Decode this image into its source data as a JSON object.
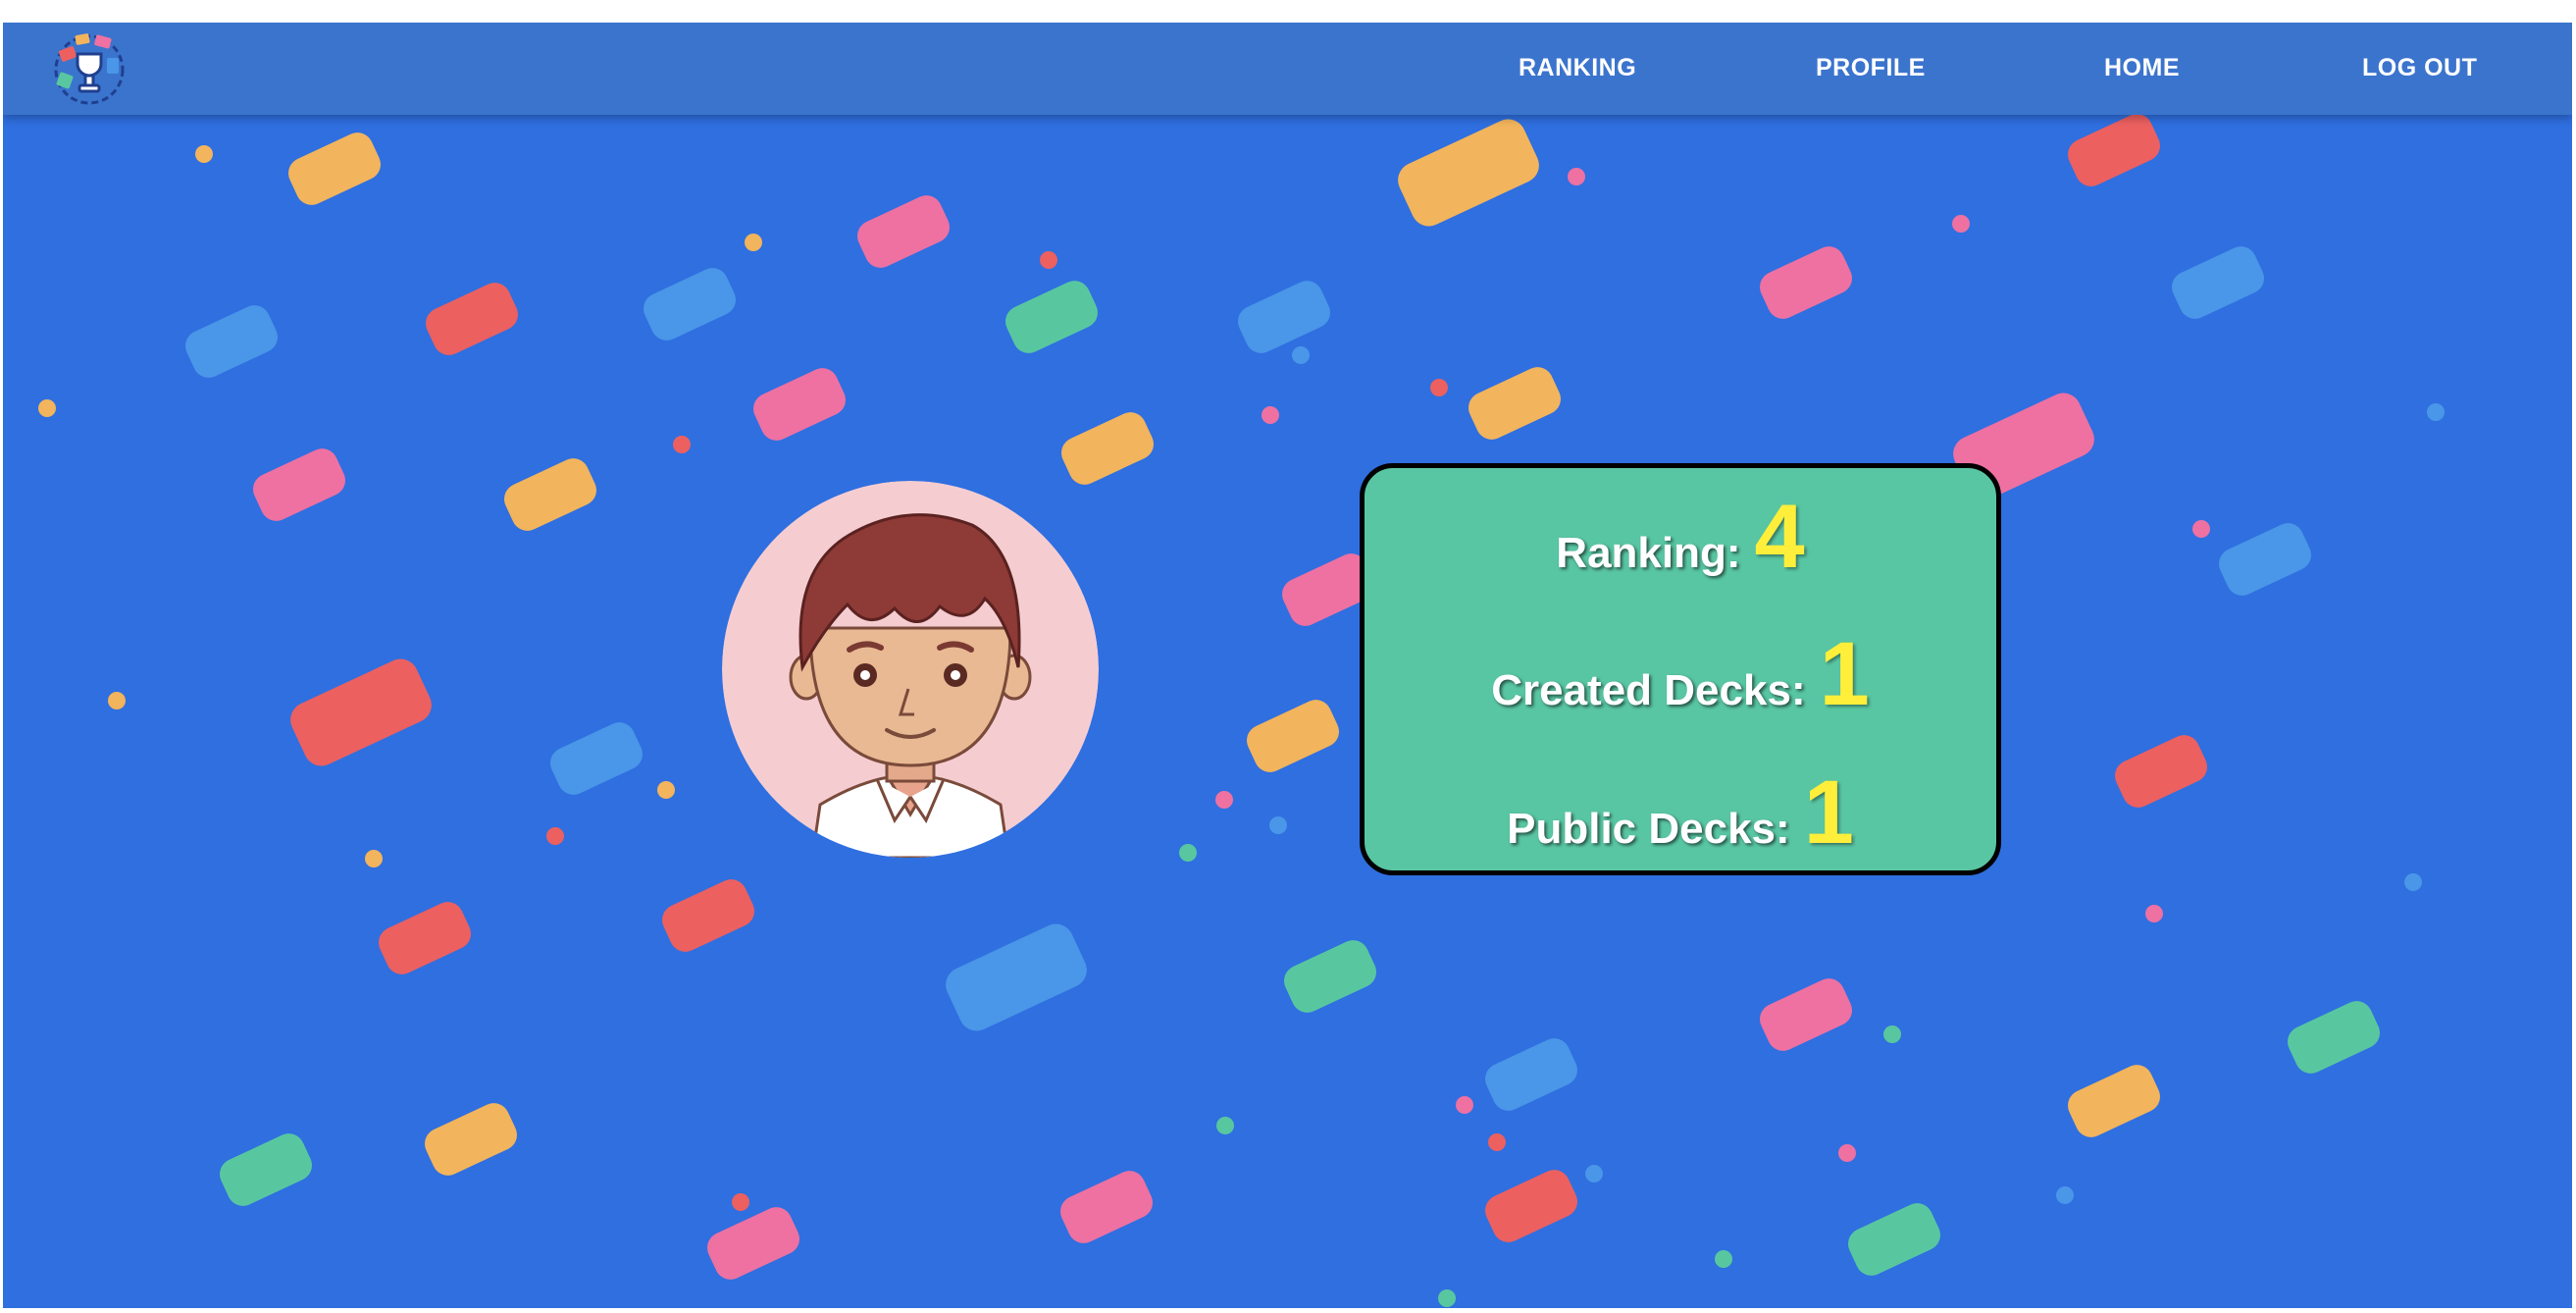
{
  "nav": {
    "logo_icon": "trophy-cards-logo-icon",
    "links": [
      "RANKING",
      "PROFILE",
      "HOME",
      "LOG OUT"
    ]
  },
  "profile": {
    "avatar_icon": "boy-avatar-icon",
    "stats": {
      "ranking_label": "Ranking:",
      "ranking_value": "4",
      "created_decks_label": "Created Decks:",
      "created_decks_value": "1",
      "public_decks_label": "Public Decks:",
      "public_decks_value": "1"
    }
  },
  "colors": {
    "background": "#2f6fe0",
    "topbar": "#3b74cd",
    "card": "#59c6a3",
    "stat_value": "#ffef3b",
    "confetti_orange": "#f2b45c",
    "confetti_pink": "#ee71a2",
    "confetti_red": "#ec6060",
    "confetti_green": "#58c7a0",
    "confetti_blue": "#4a96e8"
  }
}
